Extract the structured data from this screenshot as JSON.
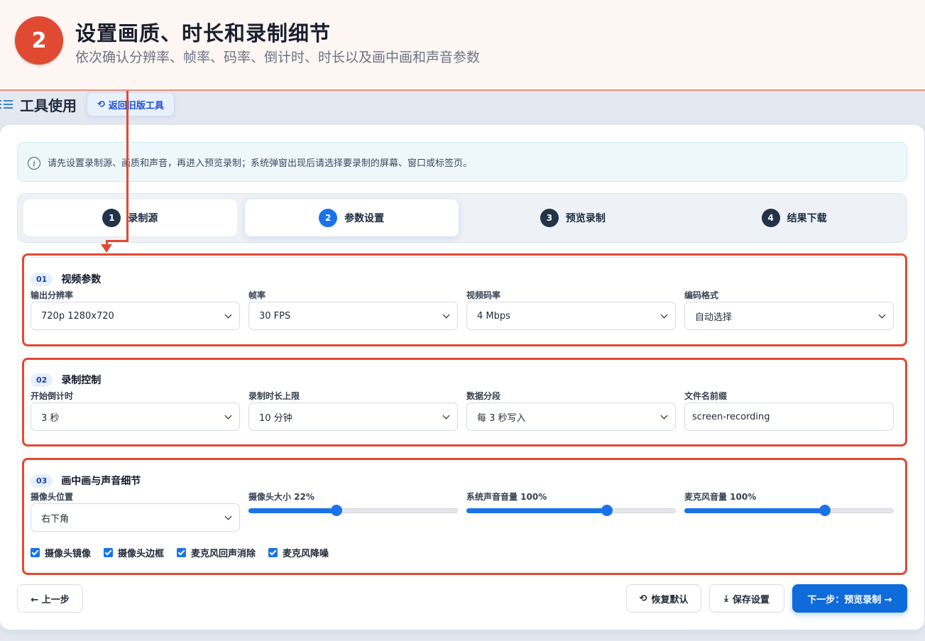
{
  "banner": {
    "step_number": "2",
    "title": "设置画质、时长和录制细节",
    "subtitle": "依次确认分辨率、帧率、码率、倒计时、时长以及画中画和声音参数"
  },
  "header": {
    "title": "工具使用",
    "old_tool_button": "返回旧版工具"
  },
  "info": {
    "text": "请先设置录制源、画质和声音，再进入预览录制；系统弹窗出现后请选择要录制的屏幕、窗口或标签页。"
  },
  "steps": [
    {
      "num": "1",
      "label": "录制源"
    },
    {
      "num": "2",
      "label": "参数设置"
    },
    {
      "num": "3",
      "label": "预览录制"
    },
    {
      "num": "4",
      "label": "结果下载"
    }
  ],
  "video": {
    "badge": "01",
    "title": "视频参数",
    "fields": [
      {
        "label": "输出分辨率",
        "value": "720p 1280x720"
      },
      {
        "label": "帧率",
        "value": "30 FPS"
      },
      {
        "label": "视频码率",
        "value": "4 Mbps"
      },
      {
        "label": "编码格式",
        "value": "自动选择"
      }
    ]
  },
  "record": {
    "badge": "02",
    "title": "录制控制",
    "fields": [
      {
        "label": "开始倒计时",
        "value": "3 秒"
      },
      {
        "label": "录制时长上限",
        "value": "10 分钟"
      },
      {
        "label": "数据分段",
        "value": "每 3 秒写入"
      },
      {
        "label": "文件名前缀",
        "value": "screen-recording"
      }
    ]
  },
  "pip": {
    "badge": "03",
    "title": "画中画与声音细节",
    "position_label": "摄像头位置",
    "position_value": "右下角",
    "camera_size_label": "摄像头大小 22%",
    "camera_size": 0.42,
    "system_volume_label": "系统声音音量 100%",
    "system_volume": 0.67,
    "mic_volume_label": "麦克风音量 100%",
    "mic_volume": 0.67,
    "checks": [
      {
        "label": "摄像头镜像",
        "checked": true
      },
      {
        "label": "摄像头边框",
        "checked": true
      },
      {
        "label": "麦克风回声消除",
        "checked": true
      },
      {
        "label": "麦克风降噪",
        "checked": true
      }
    ]
  },
  "footer": {
    "prev": "← 上一步",
    "reset": "恢复默认",
    "save": "保存设置",
    "next": "下一步：预览录制 →"
  },
  "colors": {
    "accent": "#1a73e8",
    "annotation": "#e04a32"
  }
}
